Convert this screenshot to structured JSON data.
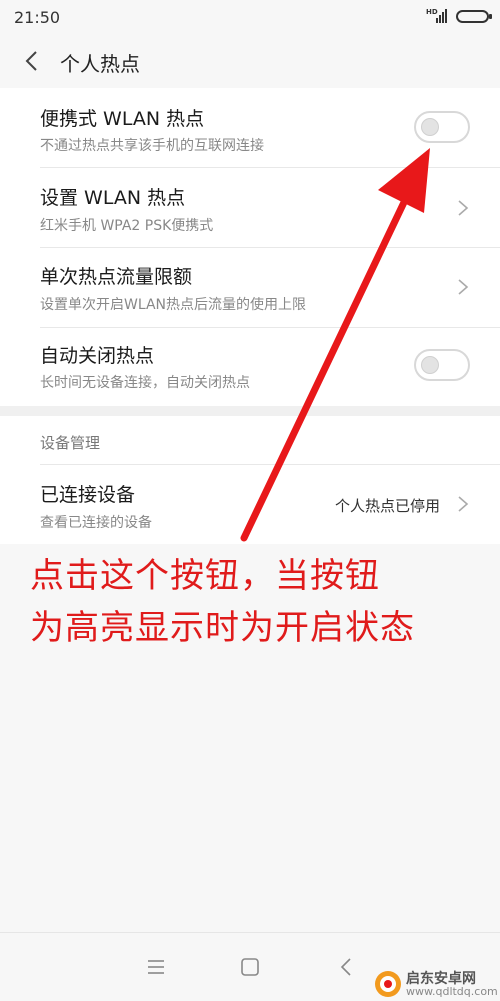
{
  "status_bar": {
    "time": "21:50",
    "network": "HD"
  },
  "header": {
    "title": "个人热点"
  },
  "rows": [
    {
      "title": "便携式 WLAN 热点",
      "subtitle": "不通过热点共享该手机的互联网连接",
      "control": "toggle",
      "enabled": false
    },
    {
      "title": "设置 WLAN 热点",
      "subtitle": "红米手机 WPA2 PSK便携式",
      "control": "chevron"
    },
    {
      "title": "单次热点流量限额",
      "subtitle": "设置单次开启WLAN热点后流量的使用上限",
      "control": "chevron"
    },
    {
      "title": "自动关闭热点",
      "subtitle": "长时间无设备连接，自动关闭热点",
      "control": "toggle",
      "enabled": false
    }
  ],
  "device_section": {
    "label": "设备管理",
    "row": {
      "title": "已连接设备",
      "subtitle": "查看已连接的设备",
      "value": "个人热点已停用"
    }
  },
  "annotation": {
    "line1": "点击这个按钮，当按钮",
    "line2": "为高亮显示时为开启状态",
    "color": "#e01b1b"
  },
  "nav": {
    "icons": [
      "menu-icon",
      "home-icon",
      "back-icon"
    ]
  },
  "watermark": {
    "name": "启东安卓网",
    "url": "www.qdltdq.com"
  }
}
